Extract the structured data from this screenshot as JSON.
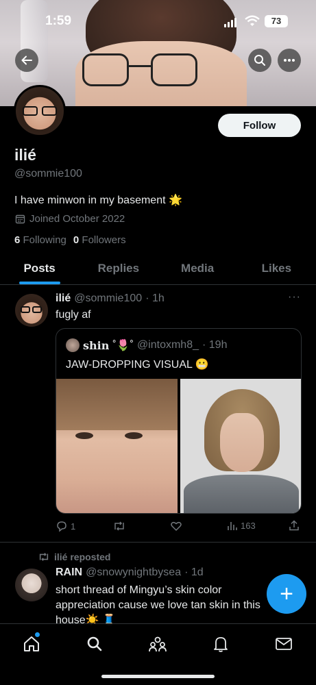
{
  "status_bar": {
    "time": "1:59",
    "battery": "73"
  },
  "profile": {
    "display_name": "ilié",
    "handle": "@sommie100",
    "bio": "I have minwon in my basement 🌟",
    "joined": "Joined October 2022",
    "following_count": "6",
    "following_label": "Following",
    "followers_count": "0",
    "followers_label": "Followers",
    "follow_label": "Follow"
  },
  "tabs": [
    {
      "label": "Posts",
      "active": true
    },
    {
      "label": "Replies",
      "active": false
    },
    {
      "label": "Media",
      "active": false
    },
    {
      "label": "Likes",
      "active": false
    }
  ],
  "post": {
    "name": "ilié",
    "handle": "@sommie100",
    "time": "· 1h",
    "more": "···",
    "text": "fugly af",
    "quote": {
      "name": "shin",
      "emoji": "˚🌷˚",
      "handle": "@intoxmh8_",
      "time": "· 19h",
      "text": "JAW-DROPPING VISUAL 😬"
    },
    "actions": {
      "replies": "1",
      "reposts": "",
      "likes": "",
      "views": "163"
    }
  },
  "repost": {
    "label": "ilié reposted",
    "name": "RAIN",
    "handle": "@snowynightbysea",
    "time": "· 1d",
    "text": "short thread of Mingyu’s skin color appreciation cause we love tan skin in this house☀️ 🧵"
  },
  "fab_label": "+",
  "colors": {
    "accent": "#1d9bf0",
    "text": "#e7e9ea",
    "muted": "#71767b",
    "border": "#2f3336"
  },
  "nav_icons": [
    "home-icon",
    "search-icon",
    "communities-icon",
    "notifications-icon",
    "messages-icon"
  ]
}
